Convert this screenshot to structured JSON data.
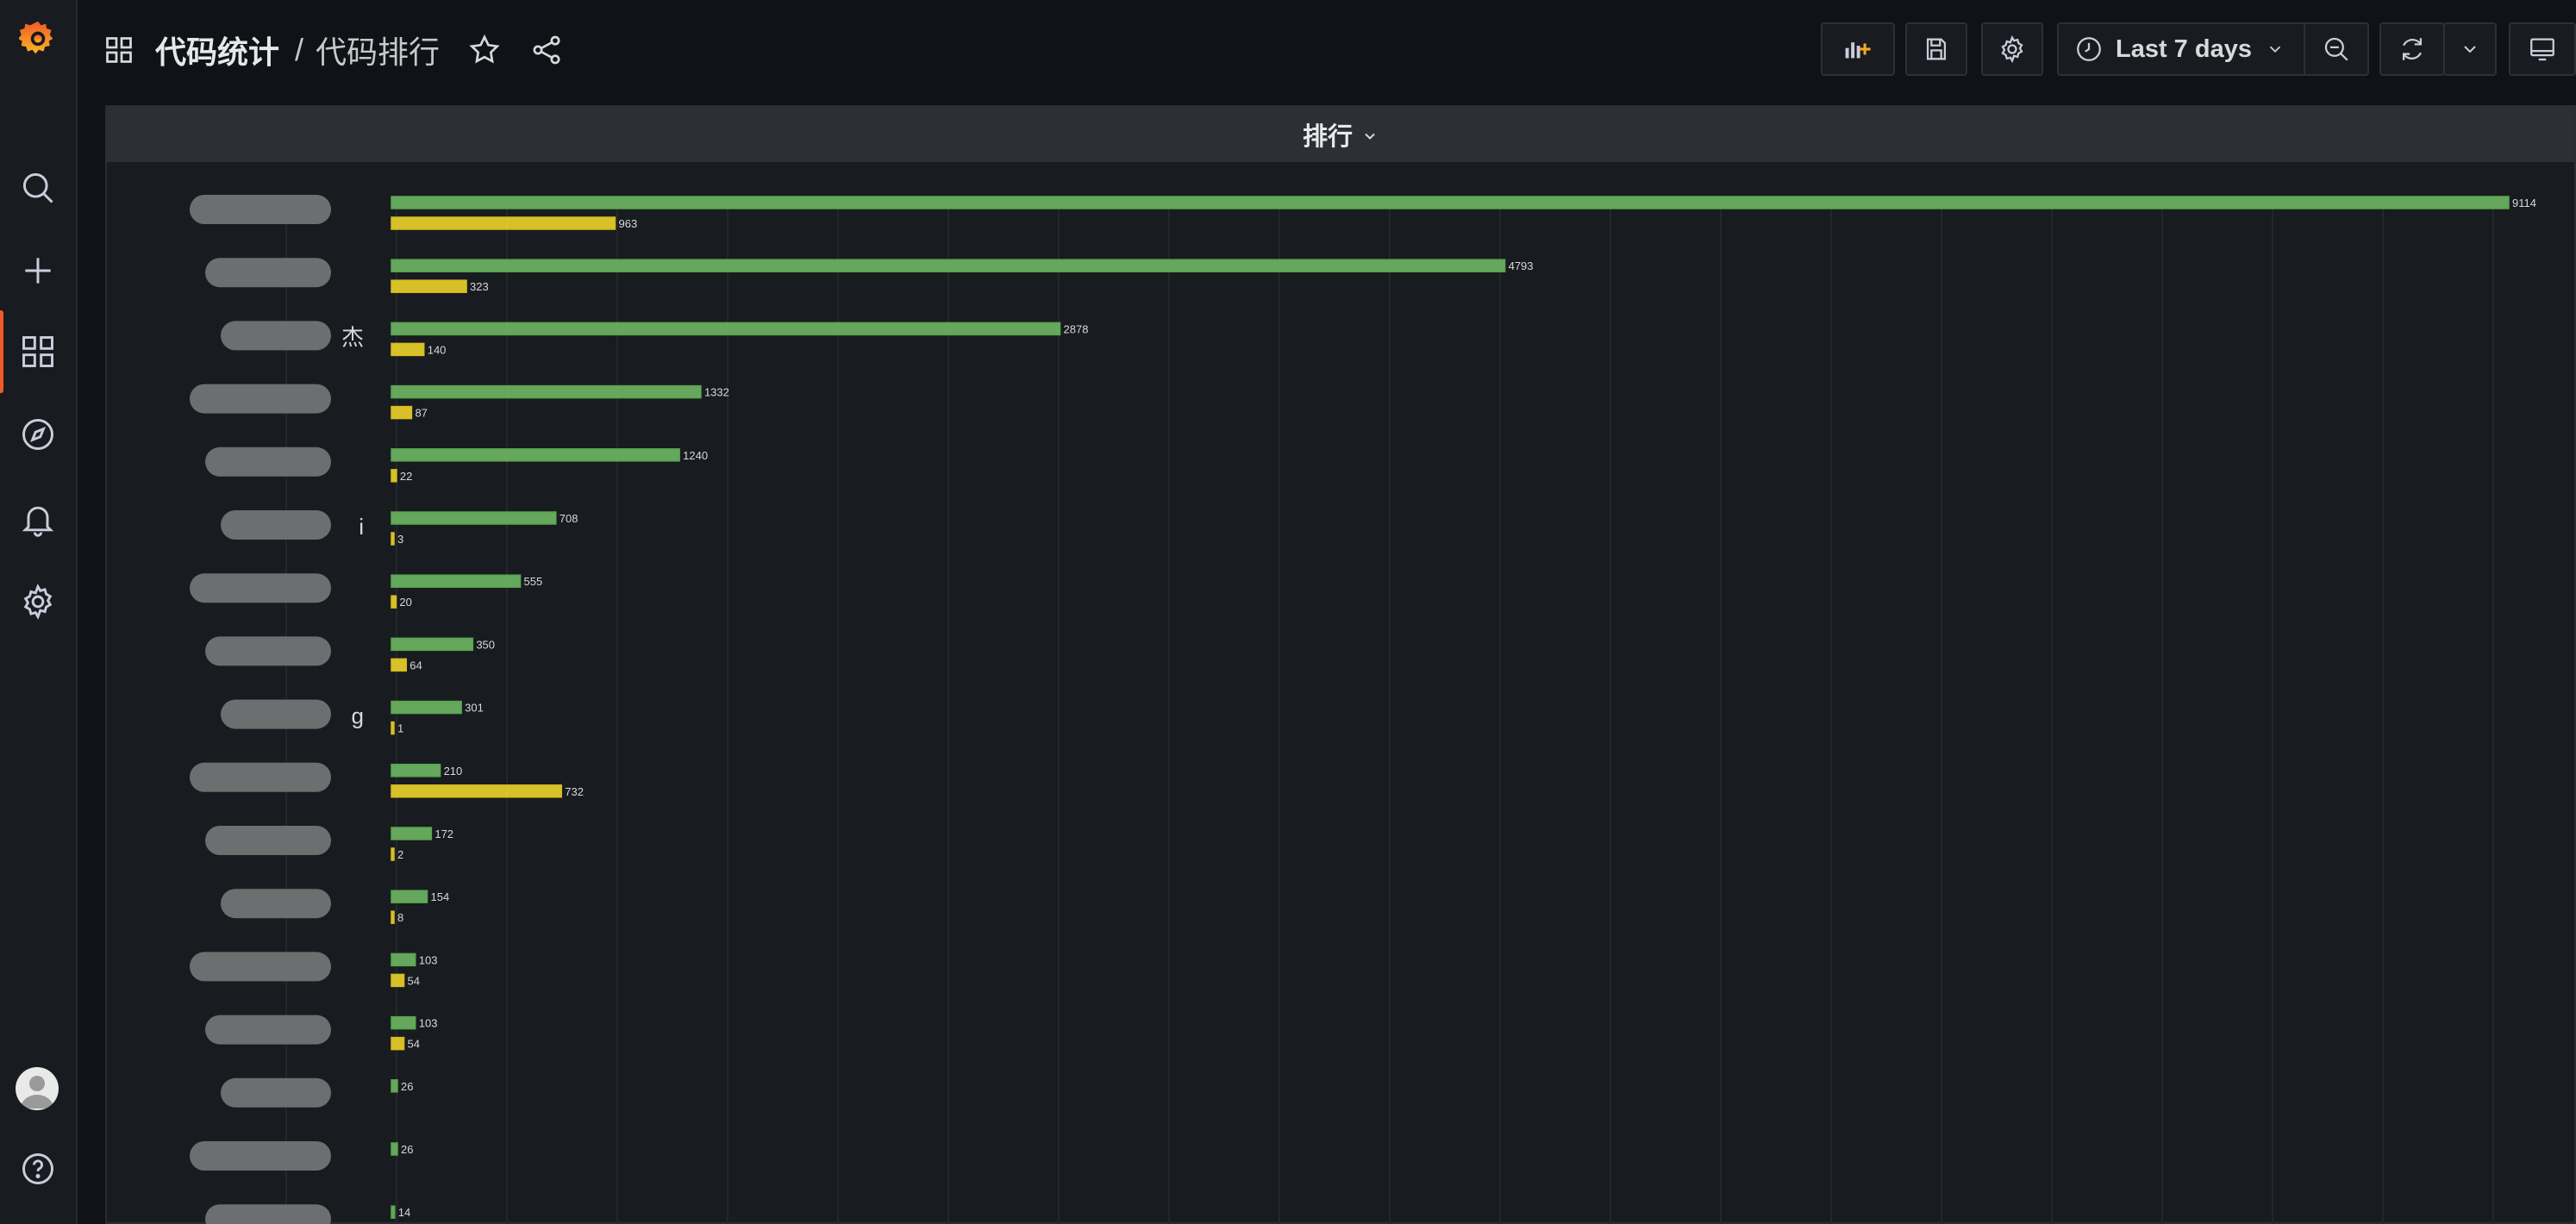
{
  "breadcrumb": {
    "folder": "代码统计",
    "separator": "/",
    "dashboard": "代码排行"
  },
  "time_picker": {
    "label": "Last 7 days"
  },
  "panel": {
    "title": "排行"
  },
  "chart_data": {
    "type": "bar",
    "orientation": "horizontal",
    "grid": true,
    "xlim": [
      0,
      10000
    ],
    "categories": [
      "",
      "",
      "杰",
      "",
      "",
      "i",
      "",
      "",
      "g",
      "",
      "",
      "",
      "",
      "",
      "",
      "",
      ""
    ],
    "series": [
      {
        "color": "#73bf69",
        "values": [
          9114,
          4793,
          2878,
          1332,
          1240,
          708,
          555,
          350,
          301,
          210,
          172,
          154,
          103,
          103,
          26,
          26,
          14
        ]
      },
      {
        "color": "#fade2a",
        "values": [
          963,
          323,
          140,
          87,
          22,
          3,
          20,
          64,
          1,
          732,
          2,
          8,
          54,
          54,
          null,
          null,
          null
        ]
      }
    ]
  },
  "colors": {
    "accent": "#f05a28",
    "bar_green": "#73bf69",
    "bar_yellow": "#fade2a"
  },
  "icons": {
    "logo": "grafana-logo-icon",
    "nav": [
      "search-icon",
      "plus-icon",
      "dashboards-icon",
      "explore-icon",
      "alert-bell-icon",
      "gear-icon",
      "avatar",
      "help-icon"
    ],
    "toolbar": [
      "add-panel-icon",
      "save-icon",
      "gear-icon",
      "clock-icon",
      "chevron-down-icon",
      "zoom-out-icon",
      "refresh-icon",
      "chevron-down-icon",
      "tv-monitor-icon"
    ]
  }
}
